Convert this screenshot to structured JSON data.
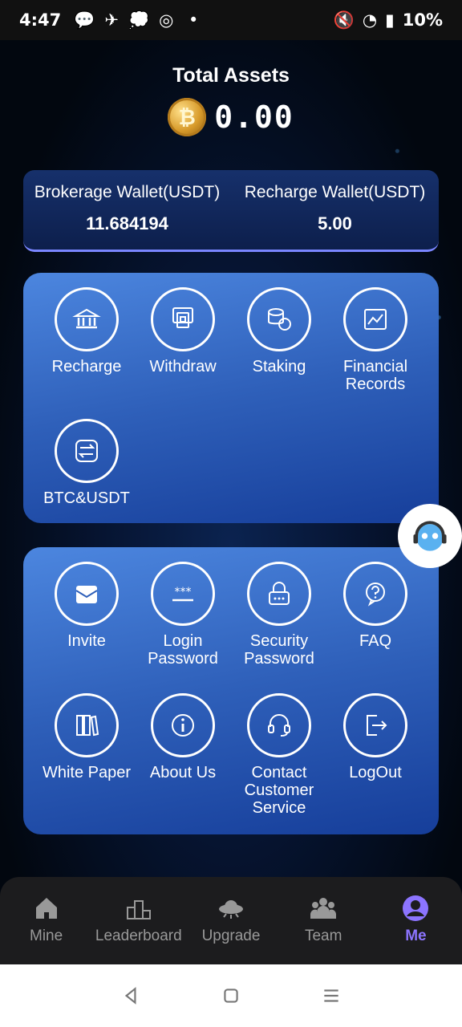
{
  "status_bar": {
    "time": "4:47",
    "battery": "10%"
  },
  "total": {
    "title": "Total Assets",
    "value": "0.00"
  },
  "wallets": [
    {
      "label": "Brokerage Wallet(USDT)",
      "value": "11.684194"
    },
    {
      "label": "Recharge Wallet(USDT)",
      "value": "5.00"
    }
  ],
  "panel1": [
    {
      "label": "Recharge",
      "icon": "bank-icon"
    },
    {
      "label": "Withdraw",
      "icon": "atm-icon"
    },
    {
      "label": "Staking",
      "icon": "coins-icon"
    },
    {
      "label": "Financial\nRecords",
      "icon": "chart-icon"
    },
    {
      "label": "BTC&USDT",
      "icon": "swap-icon"
    }
  ],
  "panel2": [
    {
      "label": "Invite",
      "icon": "envelope-icon"
    },
    {
      "label": "Login\nPassword",
      "icon": "password-icon"
    },
    {
      "label": "Security\nPassword",
      "icon": "lock-icon"
    },
    {
      "label": "FAQ",
      "icon": "question-icon"
    },
    {
      "label": "White Paper",
      "icon": "book-icon"
    },
    {
      "label": "About Us",
      "icon": "info-icon"
    },
    {
      "label": "Contact\nCustomer\nService",
      "icon": "headset-icon"
    },
    {
      "label": "LogOut",
      "icon": "logout-icon"
    }
  ],
  "tabs": [
    {
      "label": "Mine",
      "icon": "home-icon"
    },
    {
      "label": "Leaderboard",
      "icon": "podium-icon"
    },
    {
      "label": "Upgrade",
      "icon": "ufo-icon"
    },
    {
      "label": "Team",
      "icon": "team-icon"
    },
    {
      "label": "Me",
      "icon": "user-icon",
      "active": true
    }
  ],
  "colors": {
    "accent": "#8c74ff",
    "panel": "#2e5fb9"
  }
}
